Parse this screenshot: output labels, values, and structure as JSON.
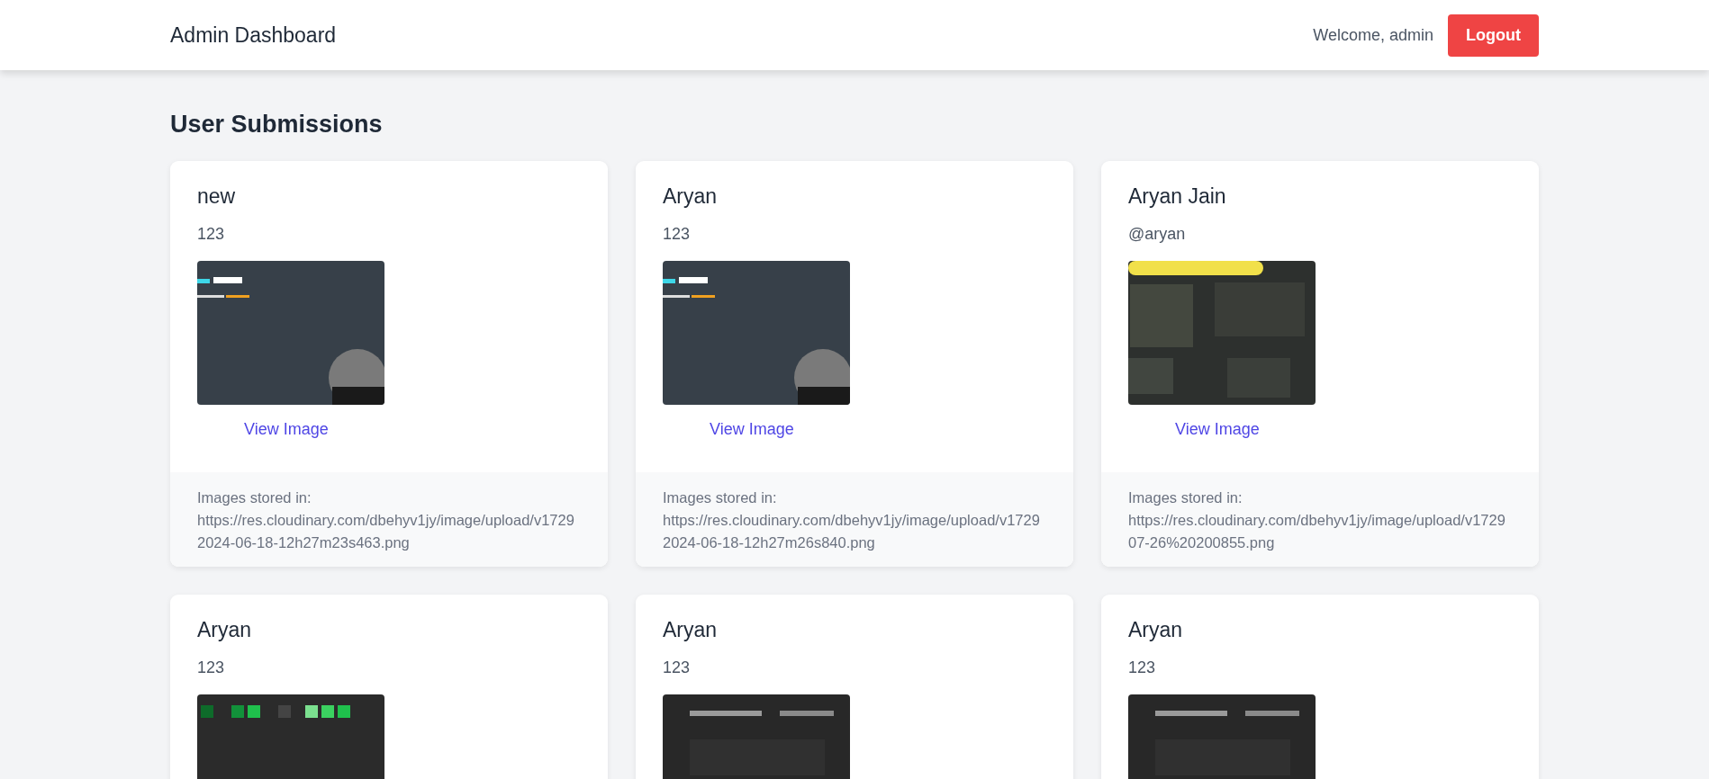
{
  "navbar": {
    "brand": "Admin Dashboard",
    "welcome": "Welcome, admin",
    "logout": "Logout"
  },
  "heading": "User Submissions",
  "submissions": [
    {
      "name": "new",
      "subtitle": "123",
      "link": "View Image",
      "storage_label": "Images stored in:",
      "storage_lines": [
        "https://res.cloudinary.com/dbehyv1jy/image/upload/v1729",
        "2024-06-18-12h27m23s463.png"
      ]
    },
    {
      "name": "Aryan",
      "subtitle": "123",
      "link": "View Image",
      "storage_label": "Images stored in:",
      "storage_lines": [
        "https://res.cloudinary.com/dbehyv1jy/image/upload/v1729",
        "2024-06-18-12h27m26s840.png"
      ]
    },
    {
      "name": "Aryan Jain",
      "subtitle": "@aryan",
      "link": "View Image",
      "storage_label": "Images stored in:",
      "storage_lines": [
        "https://res.cloudinary.com/dbehyv1jy/image/upload/v1729",
        "07-26%20200855.png"
      ]
    },
    {
      "name": "Aryan",
      "subtitle": "123"
    },
    {
      "name": "Aryan",
      "subtitle": "123"
    },
    {
      "name": "Aryan",
      "subtitle": "123"
    }
  ]
}
